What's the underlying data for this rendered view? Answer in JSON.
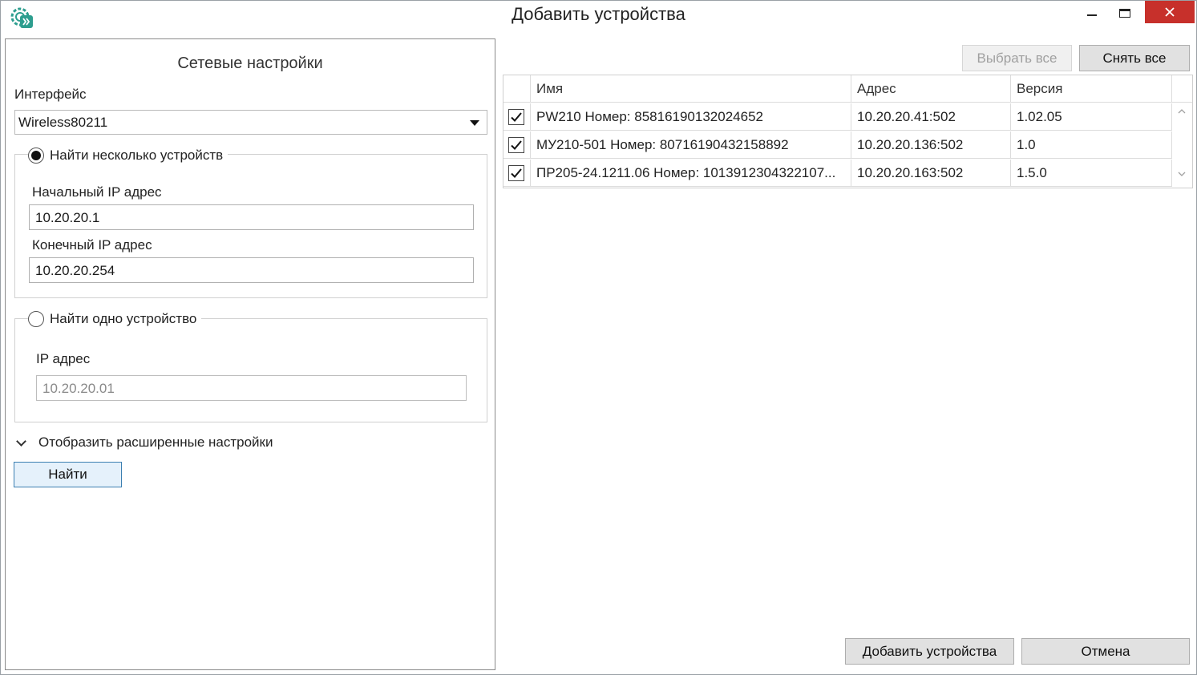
{
  "window": {
    "title": "Добавить устройства"
  },
  "network": {
    "section_title": "Сетевые настройки",
    "interface_label": "Интерфейс",
    "interface_value": "Wireless80211",
    "multi": {
      "label": "Найти несколько устройств",
      "selected": true,
      "start_ip_label": "Начальный IP адрес",
      "start_ip": "10.20.20.1",
      "end_ip_label": "Конечный IP адрес",
      "end_ip": "10.20.20.254"
    },
    "single": {
      "label": "Найти одно устройство",
      "selected": false,
      "ip_label": "IP адрес",
      "ip": "10.20.20.01"
    },
    "advanced_label": "Отобразить расширенные настройки",
    "find_label": "Найти"
  },
  "toolbar": {
    "select_all": "Выбрать все",
    "deselect_all": "Снять все"
  },
  "table": {
    "columns": [
      "Имя",
      "Адрес",
      "Версия"
    ],
    "rows": [
      {
        "checked": true,
        "name": "PW210 Номер: 85816190132024652",
        "address": "10.20.20.41:502",
        "version": "1.02.05"
      },
      {
        "checked": true,
        "name": "МУ210-501 Номер: 80716190432158892",
        "address": "10.20.20.136:502",
        "version": "1.0"
      },
      {
        "checked": true,
        "name": "ПР205-24.1211.06 Номер: 1013912304322107...",
        "address": "10.20.20.163:502",
        "version": "1.5.0"
      }
    ]
  },
  "footer": {
    "add_label": "Добавить устройства",
    "cancel_label": "Отмена"
  },
  "icons": {
    "app": "gear-arrow-icon",
    "minimize": "minimize-icon",
    "maximize": "maximize-icon",
    "close": "close-icon",
    "dropdown": "dropdown-arrow-icon",
    "expand": "chevron-down-icon",
    "check": "checkmark-icon"
  },
  "colors": {
    "close_button": "#c7302b",
    "app_icon": "#2e9e8f",
    "focus_border": "#3c7fb1"
  }
}
